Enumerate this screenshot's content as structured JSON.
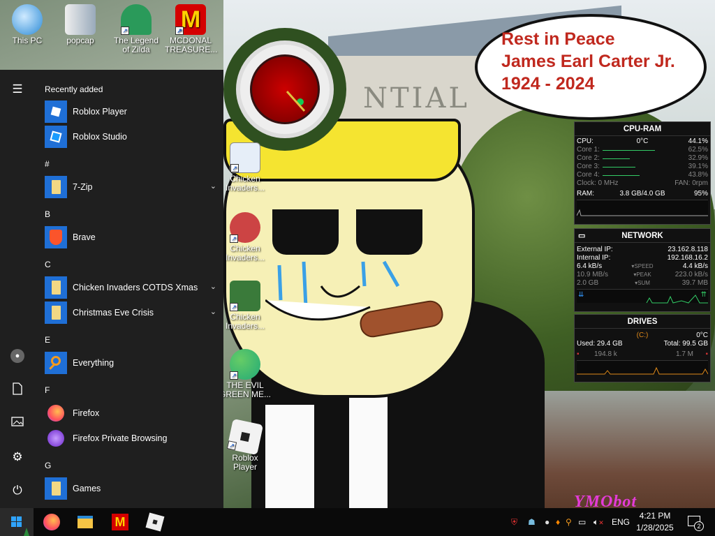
{
  "desktop": {
    "icons": [
      {
        "label": "This PC"
      },
      {
        "label": "popcap"
      },
      {
        "label": "The Legend of Zilda"
      },
      {
        "label": "MCDONAL TREASURE..."
      },
      {
        "label": "Chicken Invaders..."
      },
      {
        "label": "Chicken Invaders..."
      },
      {
        "label": "Chicken Invaders..."
      },
      {
        "label": "THE EVIL GREEN ME..."
      },
      {
        "label": "Roblox Player"
      }
    ],
    "wallpaper": {
      "speech_lines": [
        "Rest in Peace",
        "James Earl Carter Jr.",
        "1924 - 2024"
      ],
      "building_text": "NTIAL",
      "watermark": "YMObot"
    }
  },
  "start_menu": {
    "recently_added_heading": "Recently added",
    "recent": [
      {
        "label": "Roblox Player"
      },
      {
        "label": "Roblox Studio"
      }
    ],
    "sections": [
      {
        "letter": "#",
        "apps": [
          {
            "label": "7-Zip",
            "expandable": true
          }
        ]
      },
      {
        "letter": "B",
        "apps": [
          {
            "label": "Brave",
            "expandable": false
          }
        ]
      },
      {
        "letter": "C",
        "apps": [
          {
            "label": "Chicken Invaders COTDS Xmas",
            "expandable": true
          },
          {
            "label": "Christmas Eve Crisis",
            "expandable": true
          }
        ]
      },
      {
        "letter": "E",
        "apps": [
          {
            "label": "Everything",
            "expandable": false
          }
        ]
      },
      {
        "letter": "F",
        "apps": [
          {
            "label": "Firefox",
            "expandable": false
          },
          {
            "label": "Firefox Private Browsing",
            "expandable": false
          }
        ]
      },
      {
        "letter": "G",
        "apps": [
          {
            "label": "Games",
            "expandable": false
          }
        ]
      }
    ],
    "rail_icons": [
      "hamburger-icon",
      "user-icon",
      "document-icon",
      "pictures-icon",
      "settings-icon",
      "power-icon"
    ]
  },
  "cpu_ram": {
    "title": "CPU-RAM",
    "cpu_label": "CPU:",
    "cpu_temp": "0°C",
    "cpu_pct": "44.1%",
    "cores": [
      {
        "label": "Core 1:",
        "value": "62.5%",
        "load": 0.625
      },
      {
        "label": "Core 2:",
        "value": "32.9%",
        "load": 0.329
      },
      {
        "label": "Core 3:",
        "value": "39.1%",
        "load": 0.391
      },
      {
        "label": "Core 4:",
        "value": "43.8%",
        "load": 0.438
      }
    ],
    "clock": "Clock: 0 MHz",
    "fan": "FAN: 0rpm",
    "ram_label": "RAM:",
    "ram_used": "3.8 GB/4.0 GB",
    "ram_pct": "95%"
  },
  "network": {
    "title": "NETWORK",
    "external_label": "External IP:",
    "external_ip": "23.162.8.118",
    "internal_label": "Internal IP:",
    "internal_ip": "192.168.16.2",
    "speed_down": "6.4 kB/s",
    "speed_label": "SPEED",
    "speed_up": "4.4 kB/s",
    "peak_down": "10.9 MB/s",
    "peak_label": "PEAK",
    "peak_up": "223.0 kB/s",
    "sum_down": "2.0 GB",
    "sum_label": "SUM",
    "sum_up": "39.7 MB"
  },
  "drives": {
    "title": "DRIVES",
    "drive": "(C:)",
    "temp": "0°C",
    "used": "Used: 29.4 GB",
    "total": "Total: 99.5 GB",
    "read": "194.8 k",
    "write": "1.7 M"
  },
  "taskbar": {
    "pinned": [
      "start-button",
      "firefox-icon",
      "file-explorer-icon",
      "mcdonalds-icon",
      "roblox-icon"
    ],
    "language": "ENG",
    "time": "4:21 PM",
    "date": "1/28/2025",
    "notification_count": "2"
  },
  "colors": {
    "start_bg": "#1f1f1f",
    "tile_blue": "#1f6fd6",
    "taskbar_bg": "#0a0a0a",
    "speech_text": "#c0281e"
  }
}
